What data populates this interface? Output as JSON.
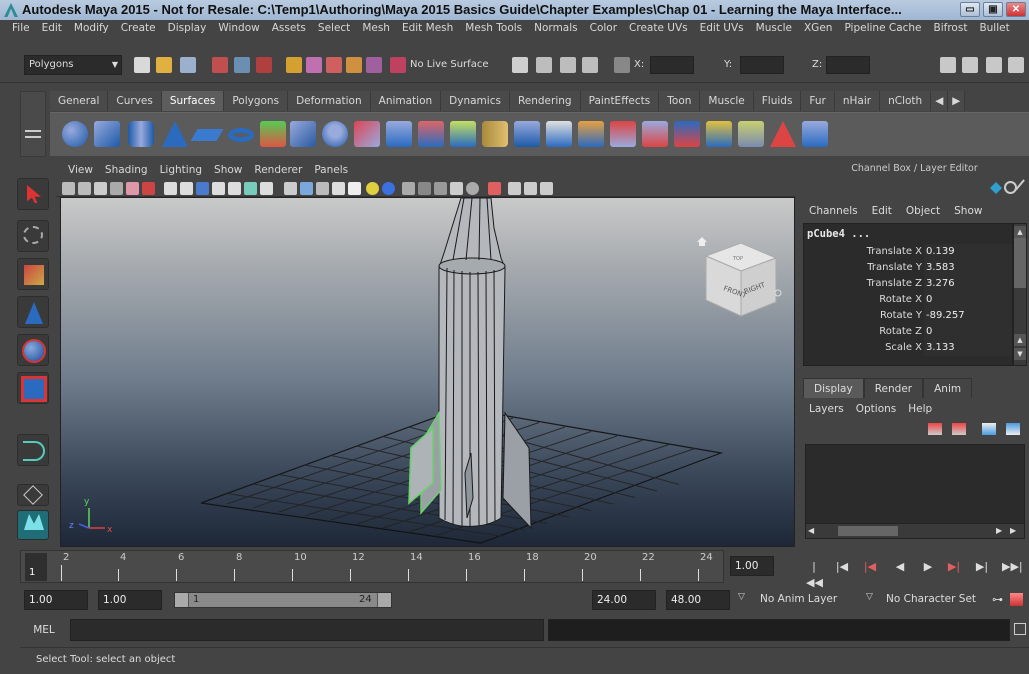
{
  "title": {
    "text": "Autodesk Maya 2015 - Not for Resale: C:\\Temp1\\Authoring\\Maya 2015 Basics Guide\\Chapter Examples\\Chap 01 - Learning the Maya Interface...",
    "minimize": "▭",
    "maximize": "▣",
    "close": "✕"
  },
  "menubar": [
    "File",
    "Edit",
    "Modify",
    "Create",
    "Display",
    "Window",
    "Assets",
    "Select",
    "Mesh",
    "Edit Mesh",
    "Mesh Tools",
    "Normals",
    "Color",
    "Create UVs",
    "Edit UVs",
    "Muscle",
    "XGen",
    "Pipeline Cache",
    "Bifrost",
    "Bullet"
  ],
  "statusline": {
    "menuset": "Polygons",
    "live_surface": "No Live Surface",
    "x_label": "X:",
    "y_label": "Y:",
    "z_label": "Z:"
  },
  "shelf": {
    "tabs": [
      "General",
      "Curves",
      "Surfaces",
      "Polygons",
      "Deformation",
      "Animation",
      "Dynamics",
      "Rendering",
      "PaintEffects",
      "Toon",
      "Muscle",
      "Fluids",
      "Fur",
      "nHair",
      "nCloth"
    ],
    "active_tab": "Surfaces"
  },
  "panel": {
    "menus": [
      "View",
      "Shading",
      "Lighting",
      "Show",
      "Renderer",
      "Panels"
    ]
  },
  "viewcube": {
    "front": "FRONT",
    "right": "RIGHT",
    "top": "TOP"
  },
  "axis": {
    "y": "y",
    "z": "z",
    "x": "x"
  },
  "channelbox": {
    "header": "Channel Box / Layer Editor",
    "menus": [
      "Channels",
      "Edit",
      "Object",
      "Show"
    ],
    "object": "pCube4 ...",
    "channels": [
      {
        "name": "Translate X",
        "value": "0.139"
      },
      {
        "name": "Translate Y",
        "value": "3.583"
      },
      {
        "name": "Translate Z",
        "value": "3.276"
      },
      {
        "name": "Rotate X",
        "value": "0"
      },
      {
        "name": "Rotate Y",
        "value": "-89.257"
      },
      {
        "name": "Rotate Z",
        "value": "0"
      },
      {
        "name": "Scale X",
        "value": "3.133"
      }
    ]
  },
  "layer_editor": {
    "tabs": [
      "Display",
      "Render",
      "Anim"
    ],
    "active_tab": "Display",
    "menus": [
      "Layers",
      "Options",
      "Help"
    ]
  },
  "timeline": {
    "ticks": [
      "2",
      "4",
      "6",
      "8",
      "10",
      "12",
      "14",
      "16",
      "18",
      "20",
      "22",
      "24"
    ],
    "current_marker": "1",
    "current_frame": "1.00"
  },
  "range": {
    "start": "1.00",
    "playback_start": "1.00",
    "slider_start": "1",
    "slider_end": "24",
    "playback_end": "24.00",
    "end": "48.00",
    "anim_layer": "No Anim Layer",
    "character_set": "No Character Set"
  },
  "mel": {
    "label": "MEL"
  },
  "help_line": "Select Tool: select an object",
  "colors": {
    "accent": "#5d5d5d",
    "panel": "#444444",
    "field": "#2b2b2b",
    "selection_green": "#6bd36b"
  }
}
